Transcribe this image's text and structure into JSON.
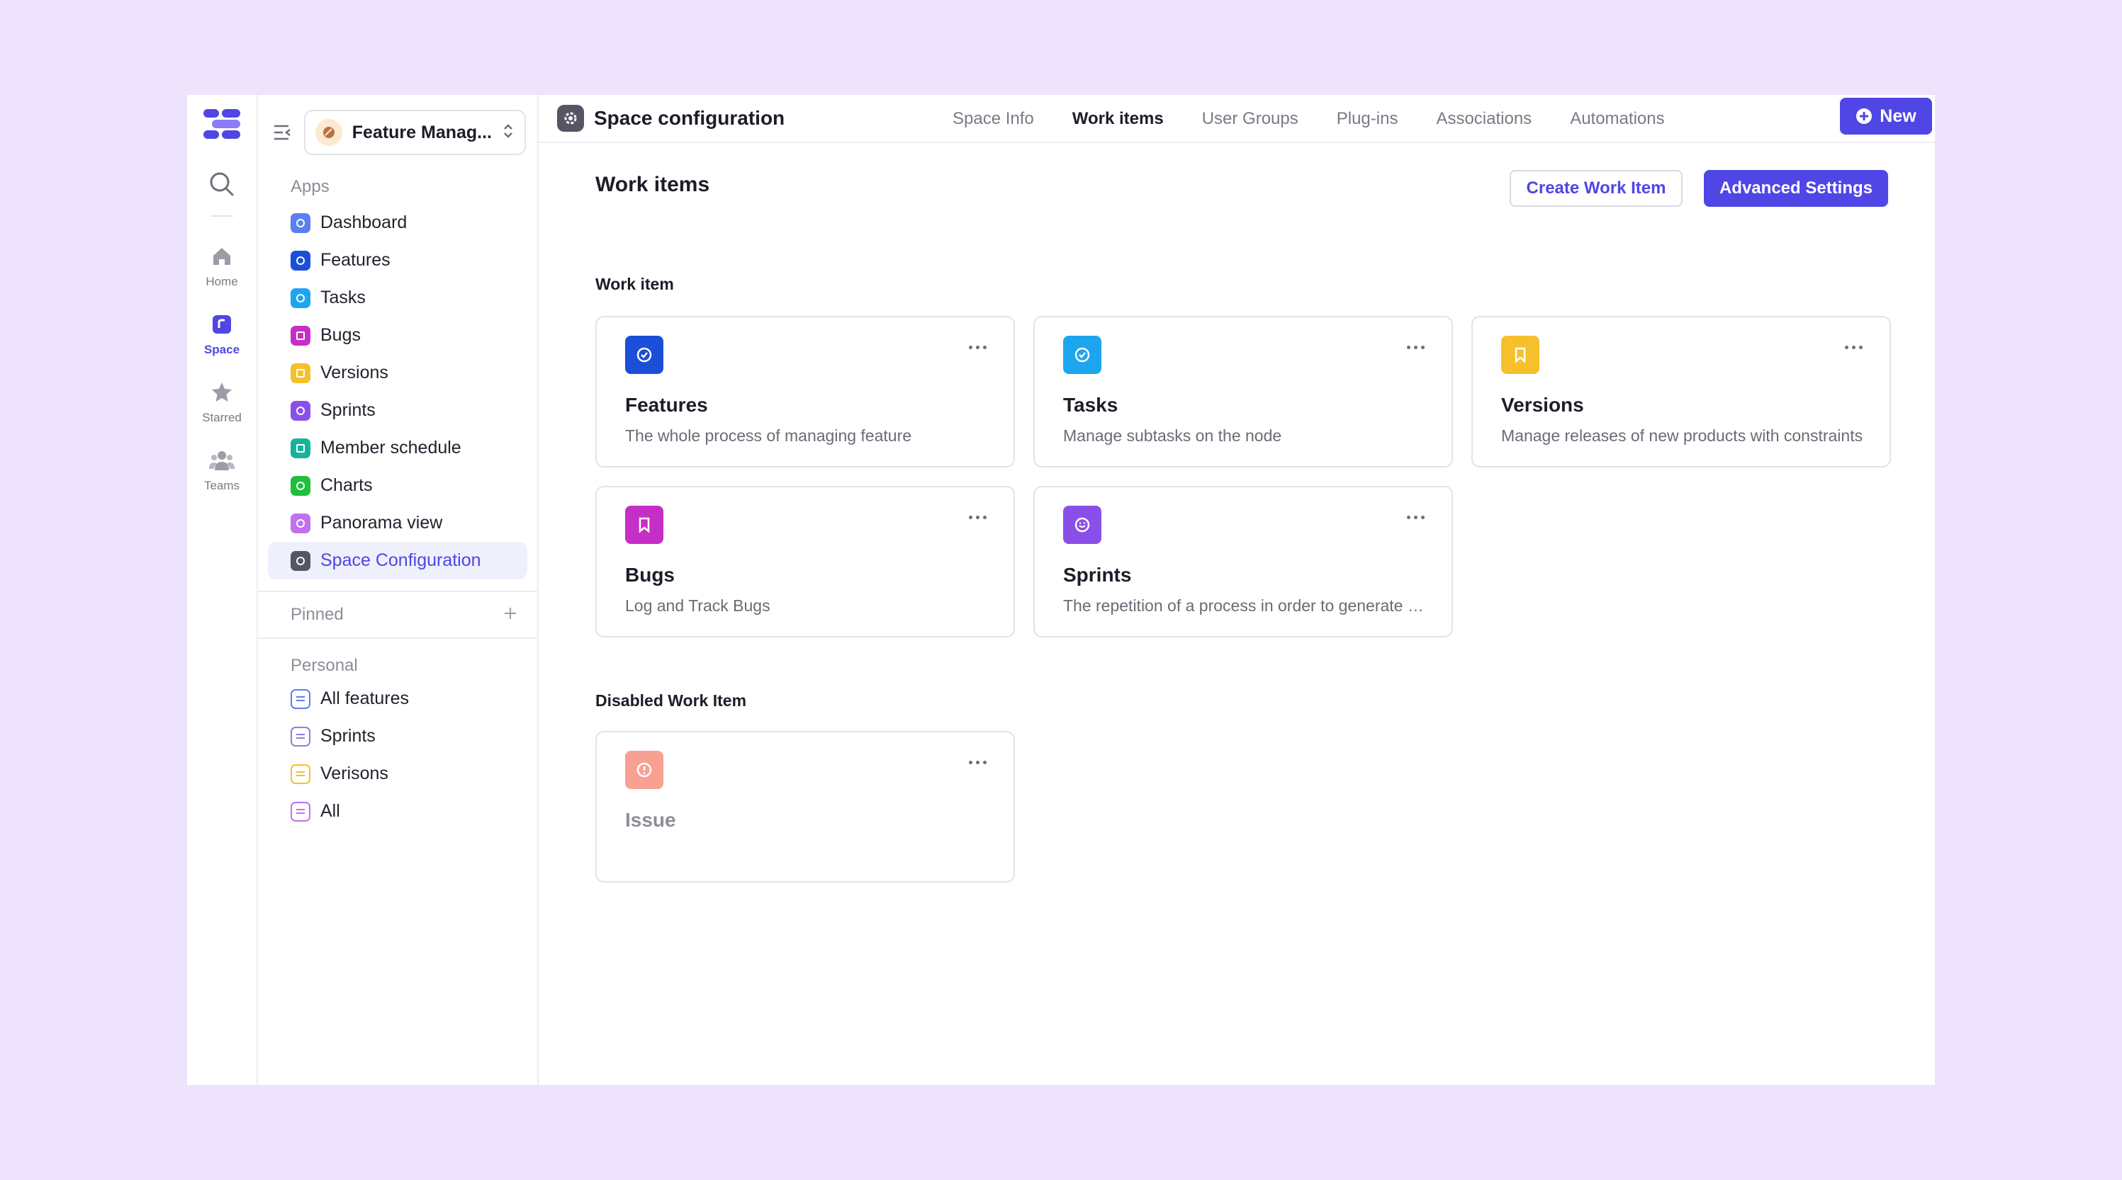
{
  "rail": {
    "items": [
      {
        "label": "Home"
      },
      {
        "label": "Space"
      },
      {
        "label": "Starred"
      },
      {
        "label": "Teams"
      }
    ]
  },
  "sidebar": {
    "project_name": "Feature Manag...",
    "apps_label": "Apps",
    "apps": [
      {
        "label": "Dashboard",
        "color": "#5b7ff0"
      },
      {
        "label": "Features",
        "color": "#1b4fd8"
      },
      {
        "label": "Tasks",
        "color": "#1ea5ef"
      },
      {
        "label": "Bugs",
        "color": "#c62fc6"
      },
      {
        "label": "Versions",
        "color": "#f5c02b"
      },
      {
        "label": "Sprints",
        "color": "#8a4fe8"
      },
      {
        "label": "Member schedule",
        "color": "#16b39a"
      },
      {
        "label": "Charts",
        "color": "#1fbf3c"
      },
      {
        "label": "Panorama view",
        "color": "#c071f0"
      },
      {
        "label": "Space Configuration",
        "color": "#555563"
      }
    ],
    "pinned_label": "Pinned",
    "personal_label": "Personal",
    "personal": [
      {
        "label": "All features",
        "color": "#5b7ff0"
      },
      {
        "label": "Sprints",
        "color": "#8a7fe8"
      },
      {
        "label": "Verisons",
        "color": "#f5c02b"
      },
      {
        "label": "All",
        "color": "#c071f0"
      }
    ]
  },
  "topbar": {
    "title": "Space configuration",
    "tabs": [
      "Space Info",
      "Work items",
      "User Groups",
      "Plug-ins",
      "Associations",
      "Automations"
    ],
    "active_tab": "Work items",
    "new_label": "New"
  },
  "main": {
    "title": "Work items",
    "create_label": "Create Work Item",
    "advanced_label": "Advanced Settings",
    "work_item_label": "Work item",
    "disabled_label": "Disabled Work Item",
    "cards": [
      {
        "title": "Features",
        "desc": "The whole process of managing feature",
        "color": "#1b4fd8",
        "icon": "check-circle-icon"
      },
      {
        "title": "Tasks",
        "desc": "Manage subtasks on the node",
        "color": "#1ea5ef",
        "icon": "check-circle-icon"
      },
      {
        "title": "Versions",
        "desc": "Manage releases of new products with constraints",
        "color": "#f5c02b",
        "icon": "bookmark-icon"
      },
      {
        "title": "Bugs",
        "desc": "Log and Track Bugs",
        "color": "#c62fc6",
        "icon": "bookmark-icon"
      },
      {
        "title": "Sprints",
        "desc": "The repetition of a process in order to generate a result",
        "color": "#8a4fe8",
        "icon": "smile-icon"
      }
    ],
    "disabled_cards": [
      {
        "title": "Issue",
        "desc": "",
        "color": "#f8a092",
        "icon": "alert-icon"
      }
    ]
  }
}
